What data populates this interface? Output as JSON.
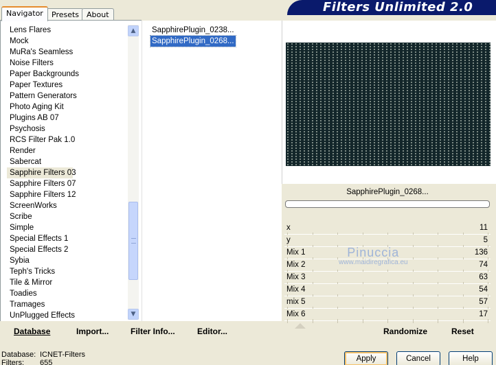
{
  "tabs": [
    {
      "label": "Navigator",
      "active": true
    },
    {
      "label": "Presets",
      "active": false
    },
    {
      "label": "About",
      "active": false
    }
  ],
  "title": "Filters Unlimited 2.0",
  "categories": {
    "items": [
      "Lens Flares",
      "Mock",
      "MuRa's Seamless",
      "Noise Filters",
      "Paper Backgrounds",
      "Paper Textures",
      "Pattern Generators",
      "Photo Aging Kit",
      "Plugins AB 07",
      "Psychosis",
      "RCS Filter Pak 1.0",
      "Render",
      "Sabercat",
      "Sapphire Filters 03",
      "Sapphire Filters 07",
      "Sapphire Filters 12",
      "ScreenWorks",
      "Scribe",
      "Simple",
      "Special Effects 1",
      "Special Effects 2",
      "Sybia",
      "Teph's Tricks",
      "Tile & Mirror",
      "Toadies",
      "Tramages",
      "UnPlugged Effects"
    ],
    "selected": "Sapphire Filters 03"
  },
  "filters": {
    "items": [
      "SapphirePlugin_0238...",
      "SapphirePlugin_0268..."
    ],
    "selected": "SapphirePlugin_0268..."
  },
  "preview": {
    "filter_name": "SapphirePlugin_0268...",
    "progress": 0
  },
  "params": [
    {
      "label": "x",
      "value": "11"
    },
    {
      "label": "y",
      "value": "5"
    },
    {
      "label": "Mix 1",
      "value": "136"
    },
    {
      "label": "Mix 2",
      "value": "74"
    },
    {
      "label": "Mix 3",
      "value": "63"
    },
    {
      "label": "Mix 4",
      "value": "54"
    },
    {
      "label": "mix 5",
      "value": "57"
    },
    {
      "label": "Mix 6",
      "value": "17"
    }
  ],
  "watermark": {
    "line1": "Pinuccia",
    "line2": "www.maidiregrafica.eu"
  },
  "bottom_links": {
    "database": "Database",
    "import": "Import...",
    "filter_info": "Filter Info...",
    "editor": "Editor...",
    "randomize": "Randomize",
    "reset": "Reset"
  },
  "status": {
    "database_label": "Database:",
    "database_value": "ICNET-Filters",
    "filters_label": "Filters:",
    "filters_value": "655"
  },
  "buttons": {
    "apply": "Apply",
    "cancel": "Cancel",
    "help": "Help"
  },
  "icons": {
    "scroll_up": "chevron-up-icon",
    "scroll_down": "chevron-down-icon"
  },
  "colors": {
    "title_banner": "#0a1a6c",
    "selection": "#316ac5",
    "preview_bg": "#13262a"
  }
}
